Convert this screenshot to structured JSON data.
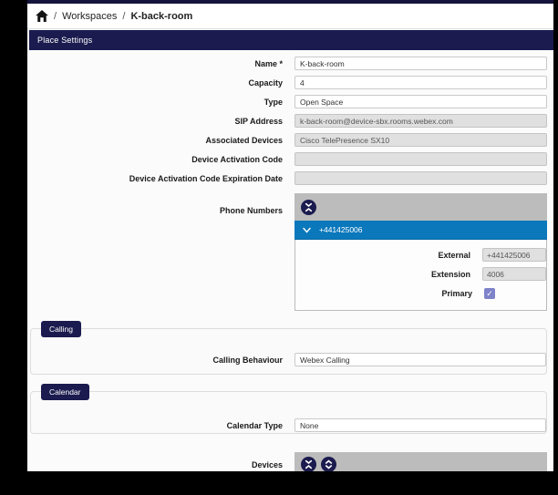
{
  "breadcrumb": {
    "separator": "/",
    "items": [
      {
        "label": "Workspaces",
        "current": false
      },
      {
        "label": "K-back-room",
        "current": true
      }
    ]
  },
  "tabbar": {
    "title": "Place Settings"
  },
  "form": {
    "fields": [
      {
        "label": "Name *",
        "value": "K-back-room",
        "disabled": false
      },
      {
        "label": "Capacity",
        "value": "4",
        "disabled": false
      },
      {
        "label": "Type",
        "value": "Open Space",
        "disabled": false
      },
      {
        "label": "SIP Address",
        "value": "k-back-room@device-sbx.rooms.webex.com",
        "disabled": true
      },
      {
        "label": "Associated Devices",
        "value": "Cisco TelePresence SX10",
        "disabled": true
      },
      {
        "label": "Device Activation Code",
        "value": "",
        "disabled": true
      },
      {
        "label": "Device Activation Code Expiration Date",
        "value": "",
        "disabled": true
      }
    ]
  },
  "phone_numbers": {
    "label": "Phone Numbers",
    "item_number": "+441425006",
    "external_label": "External",
    "external_value": "+441425006",
    "extension_label": "Extension",
    "extension_value": "4006",
    "primary_label": "Primary",
    "primary_checked": true
  },
  "calling": {
    "badge": "Calling",
    "behaviour_label": "Calling Behaviour",
    "behaviour_value": "Webex Calling"
  },
  "calendar": {
    "badge": "Calendar",
    "type_label": "Calendar Type",
    "type_value": "None"
  },
  "devices": {
    "label": "Devices"
  },
  "icons": {
    "home": "home-icon",
    "collapse_all": "collapse-all-icon",
    "expand_all": "expand-all-icon",
    "chevron_down": "chevron-down-icon",
    "check": "✓"
  },
  "colors": {
    "navy": "#1b1b4f",
    "selected_blue": "#0b78bc",
    "widget_gray": "#bcbcbc",
    "disabled_input": "#e0e0e0",
    "checkbox_indigo": "#7e82c8",
    "page_bg": "#fbfbfb",
    "letterbox": "#000000"
  }
}
